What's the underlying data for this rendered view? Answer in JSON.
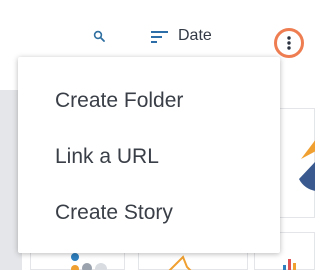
{
  "toolbar": {
    "search_icon": "search-icon",
    "sort_icon": "sort-lines-icon",
    "sort_label": "Date",
    "more_icon": "vertical-ellipsis-icon",
    "highlight_color": "#ee7d52"
  },
  "menu": {
    "items": [
      {
        "label": "Create Folder"
      },
      {
        "label": "Link a URL"
      },
      {
        "label": "Create Story"
      }
    ]
  },
  "background": {
    "chart_colors": [
      "#f0a030",
      "#2f7fbf",
      "#3a5a8f",
      "#e05050"
    ]
  }
}
